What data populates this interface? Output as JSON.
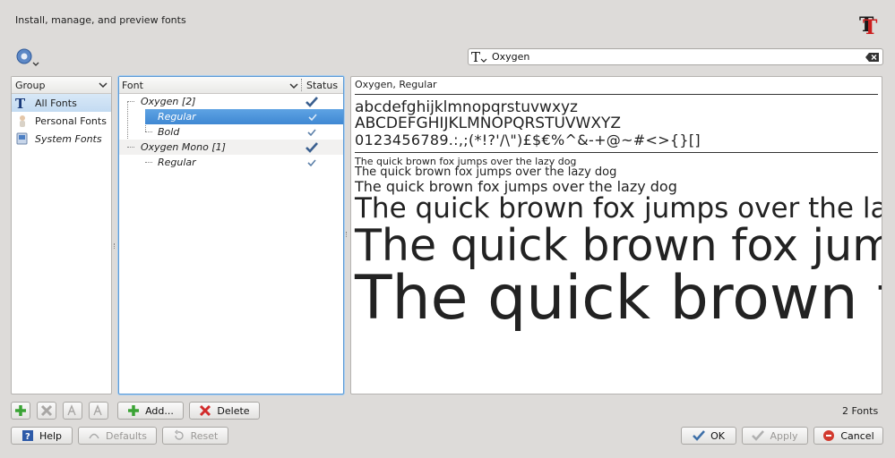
{
  "header": {
    "title": "Install, manage, and preview fonts"
  },
  "search": {
    "value": "Oxygen"
  },
  "group_panel": {
    "column": "Group",
    "items": [
      {
        "label": "All Fonts"
      },
      {
        "label": "Personal Fonts"
      },
      {
        "label": "System Fonts"
      }
    ]
  },
  "font_panel": {
    "column_font": "Font",
    "column_status": "Status",
    "rows": [
      {
        "label": "Oxygen [2]"
      },
      {
        "label": "Regular"
      },
      {
        "label": "Bold"
      },
      {
        "label": "Oxygen Mono [1]"
      },
      {
        "label": "Regular"
      }
    ]
  },
  "preview": {
    "title": "Oxygen, Regular",
    "lowercase": "abcdefghijklmnopqrstuvwxyz",
    "uppercase": "ABCDEFGHIJKLMNOPQRSTUVWXYZ",
    "digits": "0123456789.:,;(*!?'/\\\")£$€%^&-+@~#<>{}[]",
    "sample": "The quick brown fox jumps over the lazy dog"
  },
  "toolbar": {
    "add_label": "Add...",
    "delete_label": "Delete"
  },
  "status": {
    "count": "2 Fonts"
  },
  "buttons": {
    "help": "Help",
    "defaults": "Defaults",
    "reset": "Reset",
    "ok": "OK",
    "apply": "Apply",
    "cancel": "Cancel"
  },
  "colors": {
    "accent": "#4a90d9",
    "selection": "#3f88d3",
    "window": "#dddbd9"
  }
}
